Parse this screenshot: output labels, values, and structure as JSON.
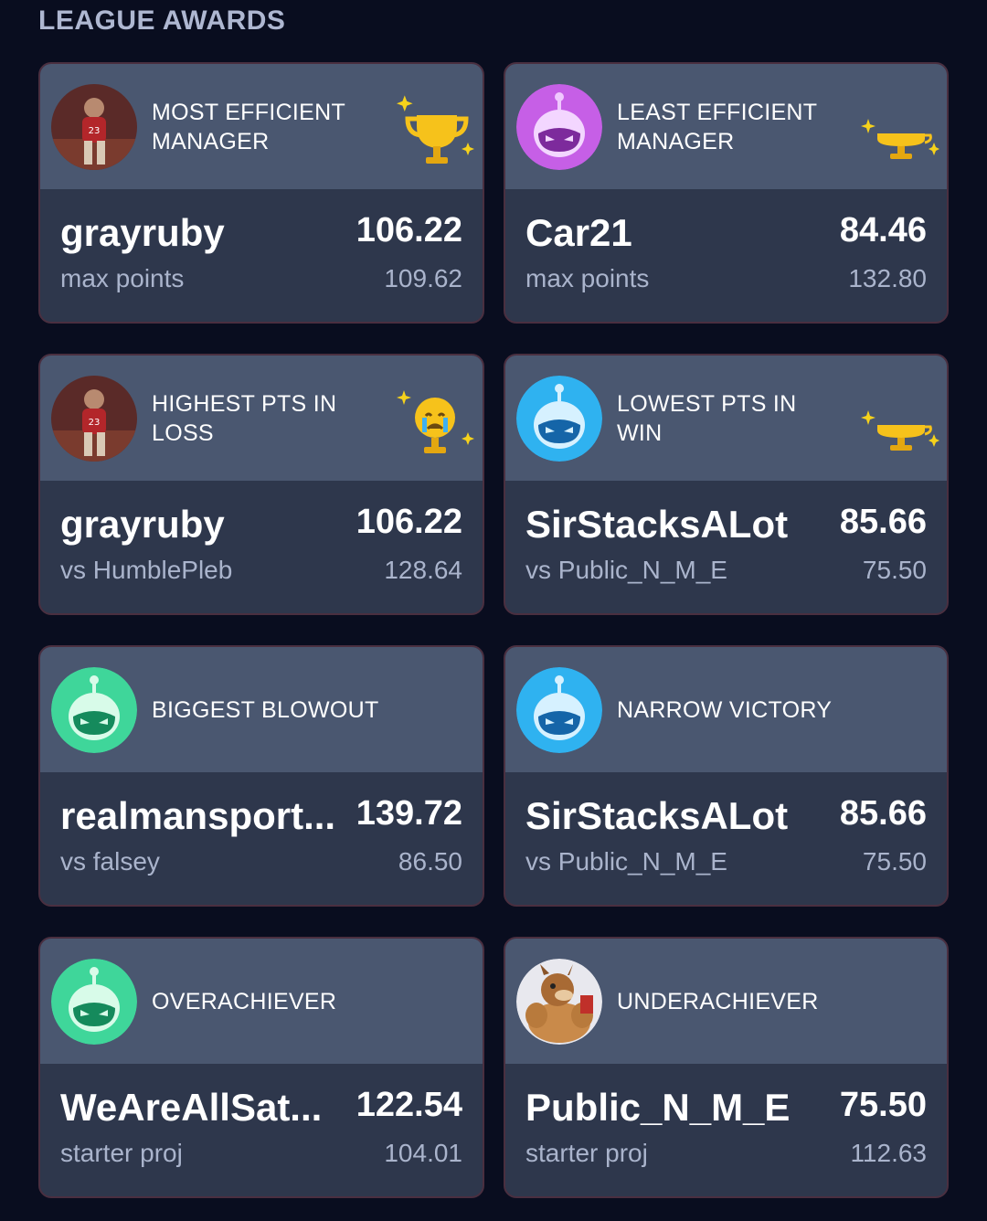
{
  "section_title": "LEAGUE AWARDS",
  "colors": {
    "card_header": "#4a5770",
    "card_body": "#2e374c",
    "background": "#090d1f",
    "trophy": "#f6c21b"
  },
  "cards": [
    {
      "avatar": "player-photo-avatar",
      "title": "MOST EFFICIENT MANAGER",
      "icon": "trophy-icon",
      "winner": "grayruby",
      "score": "106.22",
      "sub_label": "max points",
      "sub_value": "109.62"
    },
    {
      "avatar": "purple-robot-avatar",
      "title": "LEAST EFFICIENT MANAGER",
      "icon": "flat-trophy-icon",
      "winner": "Car21",
      "score": "84.46",
      "sub_label": "max points",
      "sub_value": "132.80"
    },
    {
      "avatar": "player-photo-avatar",
      "title": "HIGHEST PTS IN LOSS",
      "icon": "crying-trophy-icon",
      "winner": "grayruby",
      "score": "106.22",
      "sub_label": "vs HumblePleb",
      "sub_value": "128.64"
    },
    {
      "avatar": "blue-robot-avatar",
      "title": "LOWEST PTS IN WIN",
      "icon": "flat-trophy-icon",
      "winner": "SirStacksALot",
      "score": "85.66",
      "sub_label": "vs Public_N_M_E",
      "sub_value": "75.50"
    },
    {
      "avatar": "green-robot-avatar",
      "title": "BIGGEST BLOWOUT",
      "icon": "",
      "winner": "realmansport...",
      "score": "139.72",
      "sub_label": "vs falsey",
      "sub_value": "86.50"
    },
    {
      "avatar": "blue-robot-avatar",
      "title": "NARROW VICTORY",
      "icon": "",
      "winner": "SirStacksALot",
      "score": "85.66",
      "sub_label": "vs Public_N_M_E",
      "sub_value": "75.50"
    },
    {
      "avatar": "green-robot-avatar",
      "title": "OVERACHIEVER",
      "icon": "",
      "winner": "WeAreAllSat...",
      "score": "122.54",
      "sub_label": "starter proj",
      "sub_value": "104.01"
    },
    {
      "avatar": "muscle-dog-avatar",
      "title": "UNDERACHIEVER",
      "icon": "",
      "winner": "Public_N_M_E",
      "score": "75.50",
      "sub_label": "starter proj",
      "sub_value": "112.63"
    }
  ]
}
